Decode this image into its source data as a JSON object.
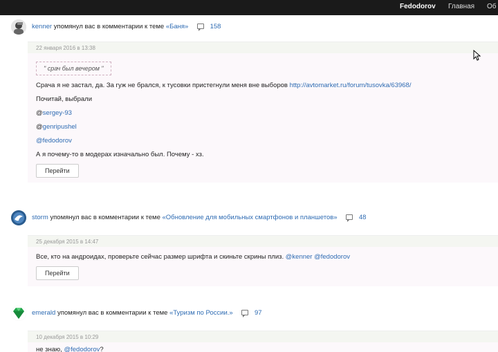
{
  "header": {
    "brand": "Fedodorov",
    "nav_home": "Главная",
    "nav_other": "Об"
  },
  "notifications": [
    {
      "user": "kenner",
      "action": "упомянул вас в комментарии к теме",
      "topic": "«Баня»",
      "comment_count": "158",
      "date": "22 января 2016 в 13:38",
      "quote": "\" срач был вечером \"",
      "para1_text": "Срача я не застал, да. За гуж не брался, к тусовки пристегнули меня вне выборов ",
      "para1_link": "http://avtomarket.ru/forum/tusovka/63968/",
      "para2": "Почитай, выбрали",
      "mention1_at": "@",
      "mention1": "sergey-93",
      "mention2_at": "@",
      "mention2": "genripushel",
      "mention3_at": "@",
      "mention3": "fedodorov",
      "para3": "А я почему-то в модерах изначально был. Почему - хз.",
      "button": "Перейти"
    },
    {
      "user": "storm",
      "action": "упомянул вас в комментарии к теме",
      "topic": "«Обновление для мобильных смартфонов и планшетов»",
      "comment_count": "48",
      "date": "25 декабря 2015 в 14:47",
      "para1_text": "Все, кто на андроидах, проверьте сейчас размер шрифта и скиньте скрины плиз. ",
      "para1_link": "@kenner @fedodorov",
      "button": "Перейти"
    },
    {
      "user": "emerald",
      "action": "упомянул вас в комментарии к теме",
      "topic": "«Туризм по России.»",
      "comment_count": "97",
      "date": "10 декабря 2015 в 10:29",
      "para1_text": "не знаю, ",
      "para1_link": "@fedodorov",
      "para1_tail": "?"
    }
  ],
  "colors": {
    "link": "#2f6cb3",
    "topbar": "#1a1a1a",
    "card_bg": "#fcf8fb",
    "date_bar": "#f4f6f1"
  },
  "icons": {
    "comment": "comment-icon",
    "cursor": "cursor-icon"
  }
}
